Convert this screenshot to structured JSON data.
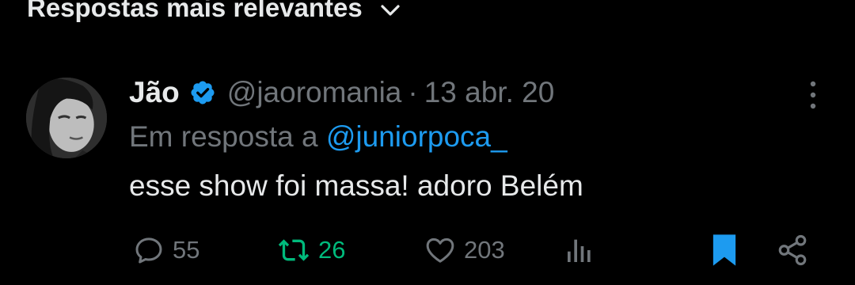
{
  "header": {
    "sort_label": "Respostas mais relevantes",
    "icon": "chevron-down-icon"
  },
  "tweet": {
    "author_name": "Jão",
    "verified": true,
    "handle": "@jaoromania",
    "separator": "·",
    "timestamp": "13 abr. 20",
    "reply_prefix": "Em resposta a",
    "reply_to": "@juniorpoca_",
    "text": "esse show foi massa! adoro Belém"
  },
  "actions": {
    "replies": "55",
    "retweets": "26",
    "likes": "203",
    "retweeted": true,
    "bookmarked": true
  },
  "colors": {
    "background": "#000000",
    "primary_text": "#e7e9ea",
    "secondary_text": "#71767b",
    "accent_blue": "#1d9bf0",
    "retweet_green": "#00ba7c"
  }
}
